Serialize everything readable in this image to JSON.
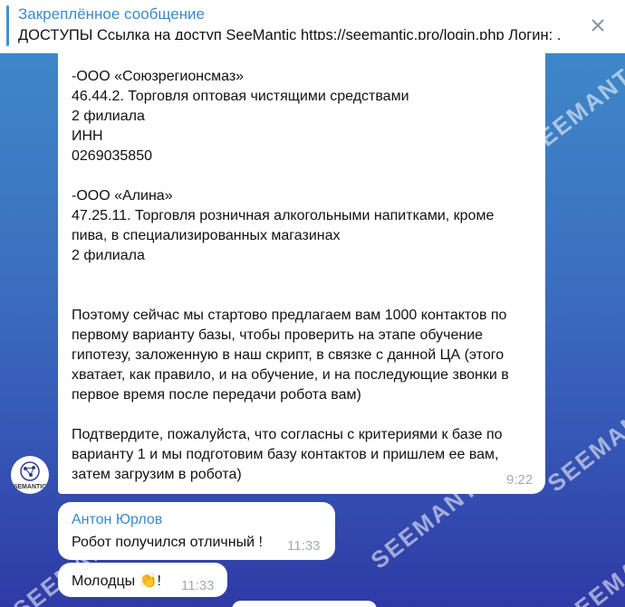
{
  "pinned": {
    "title": "Закреплённое сообщение",
    "text": "ДОСТУПЫ Ссылка на доступ SeeMantic https://seemantic.pro/login.php  Логин: ..."
  },
  "watermark": "SEEMANTIC",
  "messages": {
    "main": {
      "lines": [
        "-ООО «Союзрегионсмаз»",
        "46.44.2. Торговля оптовая чистящими средствами",
        "2 филиала",
        "ИНН",
        "0269035850",
        "",
        "-ООО «Алина»",
        "47.25.11. Торговля розничная алкогольными напитками, кроме",
        "пива, в специализированных магазинах",
        "2 филиала",
        "",
        "",
        "Поэтому сейчас мы стартово предлагаем вам 1000 контактов по",
        "первому варианту базы, чтобы проверить на этапе обучение",
        "гипотезу, заложенную в наш скрипт, в связке с данной ЦА  (этого",
        "хватает, как правило, и на обучение, и на последующие звонки в",
        "первое время после передачи робота вам)",
        "",
        "Подтвердите, пожалуйста, что согласны с критериями к базе по",
        "варианту 1 и мы подготовим базу контактов и пришлем ее вам,",
        "затем загрузим в робота)"
      ],
      "time": "9:22"
    },
    "avatar_text": "SEMANTIC",
    "reply1": {
      "sender": "Антон Юрлов",
      "text": "Робот получился отличный !",
      "time": "11:33"
    },
    "reply2": {
      "text": "Молодцы 👏!",
      "time": "11:33"
    }
  }
}
